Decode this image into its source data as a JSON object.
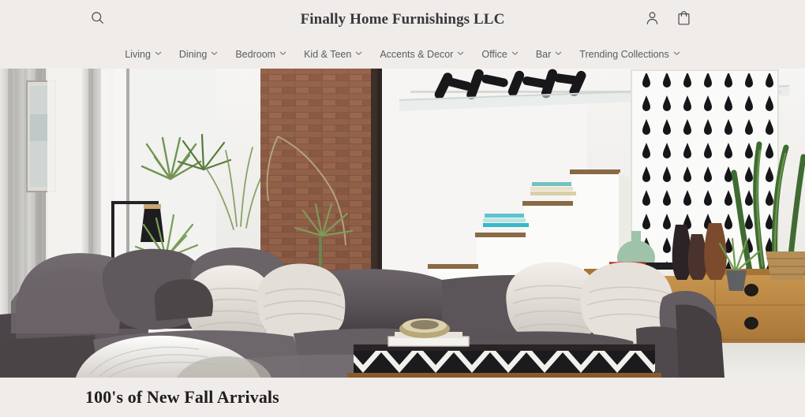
{
  "site": {
    "title": "Finally Home Furnishings LLC",
    "background_color": "#efecea",
    "text_color": "#38383a"
  },
  "header": {
    "search_icon": "search-icon",
    "account_icon": "account-person-icon",
    "cart_icon": "shopping-bag-icon"
  },
  "nav": {
    "items": [
      {
        "label": "Living",
        "has_dropdown": true
      },
      {
        "label": "Dining",
        "has_dropdown": true
      },
      {
        "label": "Bedroom",
        "has_dropdown": true
      },
      {
        "label": "Kid & Teen",
        "has_dropdown": true
      },
      {
        "label": "Accents & Decor",
        "has_dropdown": true
      },
      {
        "label": "Office",
        "has_dropdown": true
      },
      {
        "label": "Bar",
        "has_dropdown": true
      },
      {
        "label": "Trending Collections",
        "has_dropdown": true
      }
    ],
    "caret_icon": "chevron-down-icon",
    "text_color": "#5c5c5c"
  },
  "hero": {
    "alt": "Modern living room with dark gray sectional sofa, cream throw pillows, patterned ottoman, exposed brick wall, staircase, houseplants and wooden sideboard",
    "colors": {
      "sofa": "#5b5558",
      "wall": "#f2f1ef",
      "brick": "#8a5a46",
      "wood": "#b5803f",
      "plant_green": "#6f8f4a",
      "pillow": "#e8e4de"
    }
  },
  "promo": {
    "heading": "100's of New Fall Arrivals"
  }
}
